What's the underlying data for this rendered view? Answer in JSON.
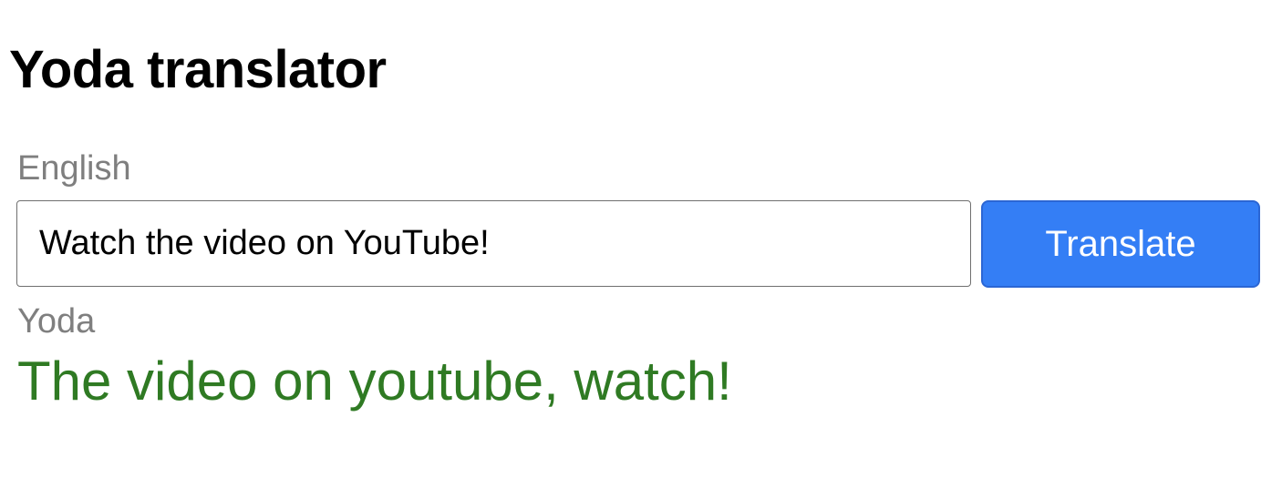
{
  "page": {
    "title": "Yoda translator"
  },
  "form": {
    "input_label": "English",
    "input_value": "Watch the video on YouTube!",
    "translate_button_label": "Translate"
  },
  "result": {
    "label": "Yoda",
    "text": "The video on youtube, watch!"
  },
  "colors": {
    "button_background": "#347ef5",
    "result_text": "#2f7a23",
    "label_text": "#7f7f7f"
  }
}
